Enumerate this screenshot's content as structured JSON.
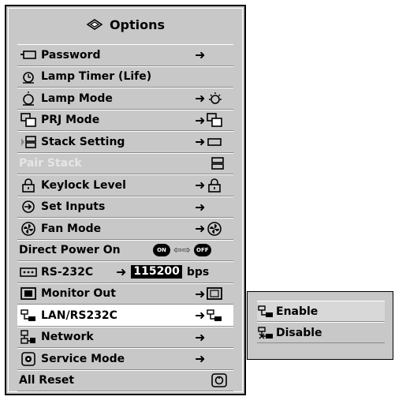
{
  "menu": {
    "title": "Options",
    "title_icon": "options-icon",
    "items": [
      {
        "label": "Password",
        "icon": "password-icon",
        "arrow": "➜"
      },
      {
        "label": "Lamp Timer (Life)",
        "icon": "lamp-timer-icon"
      },
      {
        "label": "Lamp Mode",
        "icon": "lamp-mode-icon",
        "arrow": "➜"
      },
      {
        "label": "PRJ Mode",
        "icon": "prj-mode-icon",
        "arrow": "➜"
      },
      {
        "label": "Stack Setting",
        "icon": "stack-setting-icon",
        "arrow": "➜"
      },
      {
        "label": "Pair Stack",
        "icon": "pair-stack-icon",
        "state": "disabled"
      },
      {
        "label": "Keylock Level",
        "icon": "keylock-icon",
        "arrow": "➜"
      },
      {
        "label": "Set Inputs",
        "icon": "set-inputs-icon",
        "arrow": "➜"
      },
      {
        "label": "Fan Mode",
        "icon": "fan-icon",
        "arrow": "➜"
      },
      {
        "label": "Direct Power On",
        "on_label": "ON",
        "off_label": "OFF",
        "arrow": "⇦⇨"
      },
      {
        "label": "RS-232C",
        "icon": "rs232c-icon",
        "arrow": "➜",
        "value": "115200",
        "unit": "bps"
      },
      {
        "label": "Monitor Out",
        "icon": "monitor-out-icon",
        "arrow": "➜"
      },
      {
        "label": "LAN/RS232C",
        "icon": "lan-rs232c-icon",
        "arrow": "➜",
        "state": "selected"
      },
      {
        "label": "Network",
        "icon": "network-icon",
        "arrow": "➜"
      },
      {
        "label": "Service Mode",
        "icon": "service-mode-icon",
        "arrow": "➜"
      },
      {
        "label": "All Reset",
        "icon": "reset-icon"
      }
    ]
  },
  "submenu": {
    "items": [
      {
        "label": "Enable",
        "icon": "lan-enable-icon",
        "state": "selected"
      },
      {
        "label": "Disable",
        "icon": "lan-disable-icon"
      }
    ]
  },
  "colors": {
    "panel": "#c8c8c8",
    "highlight": "#ffffff",
    "disabled_text": "#e6e6e6"
  }
}
